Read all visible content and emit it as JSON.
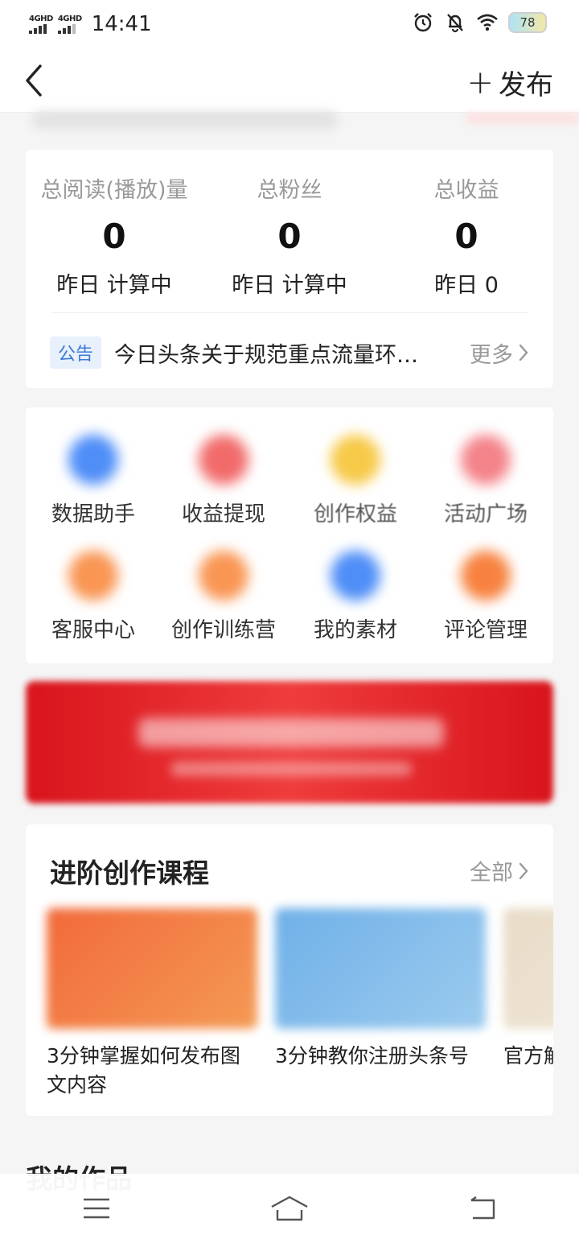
{
  "status": {
    "network1": "4GHD",
    "network2": "4GHD",
    "time": "14:41",
    "battery": "78"
  },
  "nav": {
    "publish_label": "发布"
  },
  "stats": [
    {
      "label": "总阅读(播放)量",
      "value": "0",
      "sub": "昨日 计算中"
    },
    {
      "label": "总粉丝",
      "value": "0",
      "sub": "昨日 计算中"
    },
    {
      "label": "总收益",
      "value": "0",
      "sub": "昨日 0"
    }
  ],
  "notice": {
    "tag": "公告",
    "text": "今日头条关于规范重点流量环…",
    "more": "更多"
  },
  "tools": [
    {
      "label": "数据助手",
      "color": "#4f8ef7"
    },
    {
      "label": "收益提现",
      "color": "#f26b6b"
    },
    {
      "label": "创作权益",
      "color": "#f7c948"
    },
    {
      "label": "活动广场",
      "color": "#f4838a"
    },
    {
      "label": "客服中心",
      "color": "#f99654"
    },
    {
      "label": "创作训练营",
      "color": "#f99654"
    },
    {
      "label": "我的素材",
      "color": "#4f8ef7"
    },
    {
      "label": "评论管理",
      "color": "#f7823f"
    }
  ],
  "courses": {
    "title": "进阶创作课程",
    "all_label": "全部",
    "items": [
      {
        "title": "3分钟掌握如何发布图文内容",
        "color": "#f26a3a"
      },
      {
        "title": "3分钟教你注册头条号",
        "color": "#6fb0e8"
      },
      {
        "title": "官方解读 获得头",
        "color": "#e8dcc8"
      }
    ]
  },
  "works": {
    "title": "我的作品"
  }
}
